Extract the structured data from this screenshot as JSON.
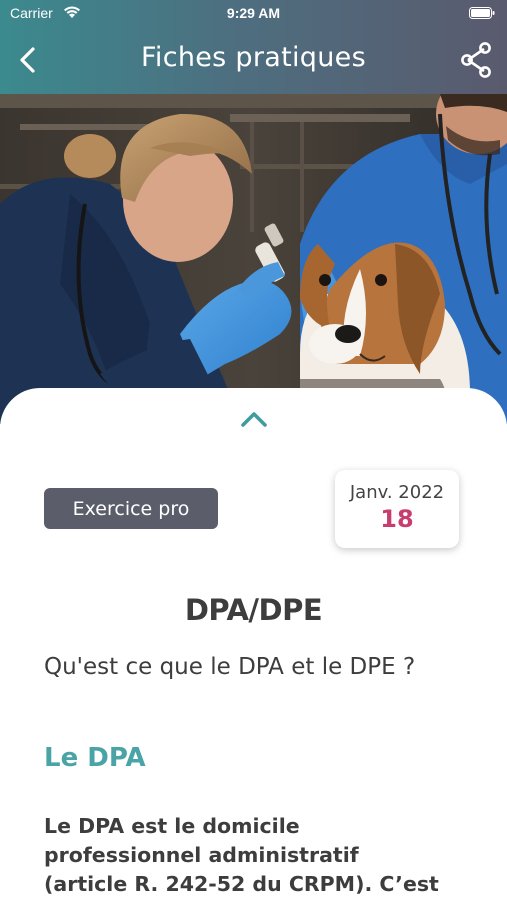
{
  "status_bar": {
    "carrier": "Carrier",
    "time": "9:29 AM",
    "wifi_icon": "wifi-icon",
    "battery_icon": "battery-icon"
  },
  "nav": {
    "title": "Fiches pratiques",
    "back_icon": "chevron-left-icon",
    "share_icon": "share-icon"
  },
  "hero_image": {
    "icon": "hero-photo"
  },
  "card": {
    "collapse_icon": "chevron-up-icon",
    "category": "Exercice pro",
    "date": {
      "month": "Janv. 2022",
      "day": "18"
    },
    "title": "DPA/DPE",
    "subtitle": "Qu'est ce que le DPA et le DPE ?",
    "section_heading": "Le DPA",
    "body_lines": [
      "Le DPA est le domicile",
      "professionnel administratif",
      "(article R. 242-52 du CRPM). C’est"
    ]
  },
  "colors": {
    "header_gradient_start": "#3b8a8e",
    "header_gradient_end": "#5a5a6e",
    "badge_bg": "#5b5d6a",
    "accent_pink": "#c73d6e",
    "accent_teal": "#4aa3a6",
    "text_dark": "#3d3d3d"
  }
}
